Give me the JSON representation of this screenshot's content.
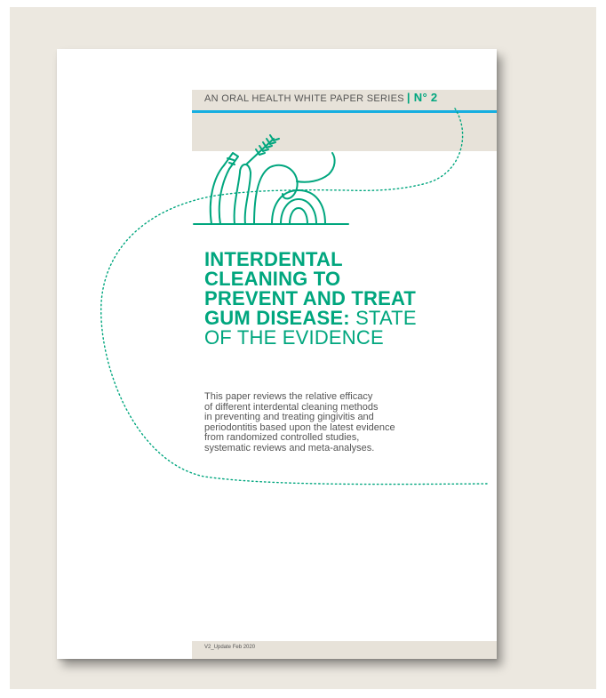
{
  "colors": {
    "accent_green": "#00a67e",
    "accent_blue": "#16aee0",
    "frame_background": "#ece8e0",
    "band_beige": "#e7e2d9"
  },
  "header": {
    "series_label": "AN ORAL HEALTH WHITE PAPER SERIES",
    "separator": "|",
    "issue_number": "N° 2"
  },
  "illustration": {
    "icon": "interdental-cleaning-tools-icon"
  },
  "title": {
    "bold_lines": [
      "INTERDENTAL",
      "CLEANING TO",
      "PREVENT AND TREAT",
      "GUM DISEASE:"
    ],
    "light_suffix": "STATE",
    "light_line": "OF THE EVIDENCE"
  },
  "abstract": {
    "lines": [
      "This paper reviews the relative efficacy",
      "of different interdental cleaning methods",
      "in preventing and treating gingivitis and",
      "periodontitis based upon the latest evidence",
      "from randomized controlled studies,",
      "systematic reviews and meta-analyses."
    ]
  },
  "footer": {
    "version": "V2_Update Feb 2020"
  }
}
